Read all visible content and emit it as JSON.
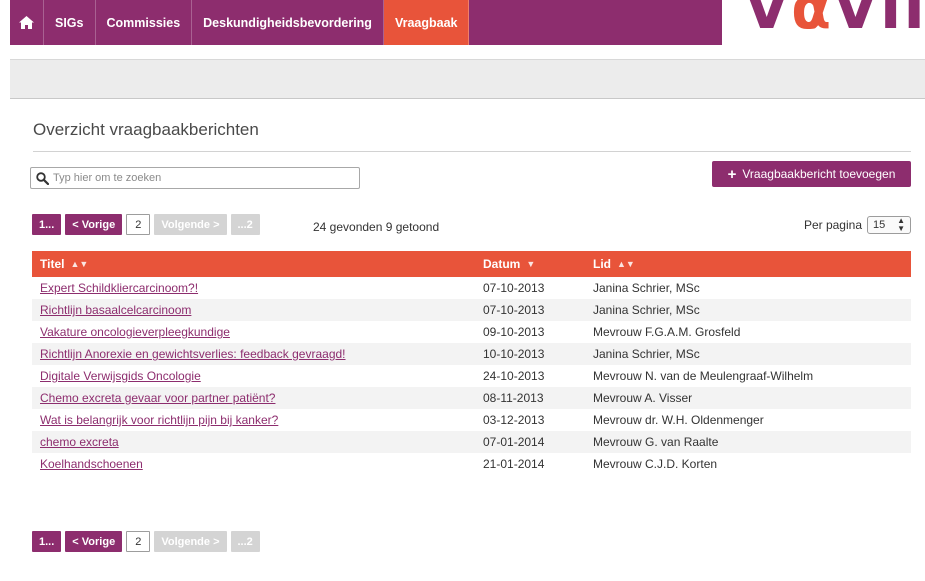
{
  "nav": {
    "items": [
      "SIGs",
      "Commissies",
      "Deskundigheidsbevordering",
      "Vraagbaak"
    ],
    "active_index": 3
  },
  "logo": {
    "text_start": "V",
    "text_o": "α",
    "text_end": "VII"
  },
  "page": {
    "title": "Overzicht vraagbaakberichten"
  },
  "search": {
    "placeholder": "Typ hier om te zoeken"
  },
  "add_button": {
    "label": "Vraagbaakbericht toevoegen"
  },
  "pager": {
    "first": "1...",
    "prev": "< Vorige",
    "current": "2",
    "next": "Volgende >",
    "last": "...2"
  },
  "found_text": "24 gevonden 9 getoond",
  "per_page": {
    "label": "Per pagina",
    "value": "15"
  },
  "table": {
    "headers": {
      "title": "Titel",
      "date": "Datum",
      "member": "Lid"
    },
    "rows": [
      {
        "title": "Expert Schildkliercarcinoom?!",
        "date": "07-10-2013",
        "member": "Janina Schrier, MSc"
      },
      {
        "title": "Richtlijn basaalcelcarcinoom",
        "date": "07-10-2013",
        "member": "Janina Schrier, MSc"
      },
      {
        "title": "Vakature oncologieverpleegkundige",
        "date": "09-10-2013",
        "member": "Mevrouw F.G.A.M. Grosfeld"
      },
      {
        "title": "Richtlijn Anorexie en gewichtsverlies: feedback gevraagd!",
        "date": "10-10-2013",
        "member": "Janina Schrier, MSc"
      },
      {
        "title": "Digitale Verwijsgids Oncologie",
        "date": "24-10-2013",
        "member": "Mevrouw N. van de Meulengraaf-Wilhelm"
      },
      {
        "title": "Chemo excreta gevaar voor partner patiënt?",
        "date": "08-11-2013",
        "member": "Mevrouw A. Visser"
      },
      {
        "title": "Wat is belangrijk voor richtlijn pijn bij kanker?",
        "date": "03-12-2013",
        "member": "Mevrouw dr. W.H. Oldenmenger"
      },
      {
        "title": "chemo excreta",
        "date": "07-01-2014",
        "member": "Mevrouw G. van Raalte"
      },
      {
        "title": "Koelhandschoenen",
        "date": "21-01-2014",
        "member": "Mevrouw C.J.D. Korten"
      }
    ]
  },
  "colors": {
    "purple": "#8d2d6e",
    "orange": "#e8543a"
  }
}
